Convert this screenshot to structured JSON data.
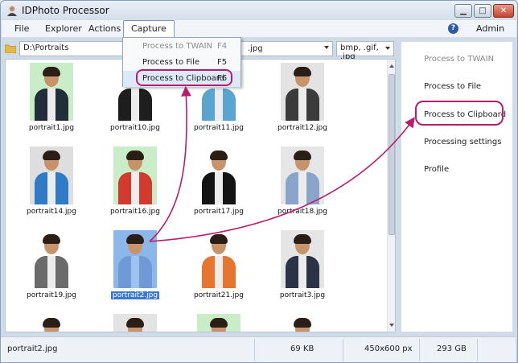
{
  "window": {
    "title": "IDPhoto Processor"
  },
  "window_controls": {
    "min": "▁",
    "max": "□",
    "close": "✕"
  },
  "menubar": {
    "items": [
      "File",
      "Explorer",
      "Actions",
      "Capture"
    ],
    "help": "?",
    "user": "Admin"
  },
  "toolbar": {
    "path": "D:\\Portraits",
    "path_type": ".jpg",
    "filter": "bmp, .gif, .jpg"
  },
  "capture_menu": {
    "items": [
      {
        "label": "Process to TWAIN",
        "shortcut": "F4",
        "disabled": true
      },
      {
        "label": "Process to File",
        "shortcut": "F5",
        "disabled": false
      },
      {
        "label": "Process to Clipboard",
        "shortcut": "F6",
        "disabled": false
      }
    ]
  },
  "gallery": {
    "items": [
      {
        "file": "portrait1.jpg",
        "bg": "#c9eec7",
        "shirt": "#222e3a"
      },
      {
        "file": "portrait10.jpg",
        "bg": "#ffffff",
        "shirt": "#1e1e1e"
      },
      {
        "file": "portrait11.jpg",
        "bg": "#ffffff",
        "shirt": "#5aa5d0"
      },
      {
        "file": "portrait12.jpg",
        "bg": "#e3e3e3",
        "shirt": "#3b3b3b"
      },
      {
        "file": "portrait14.jpg",
        "bg": "#dedede",
        "shirt": "#2f7bc8"
      },
      {
        "file": "portrait16.jpg",
        "bg": "#c9eec7",
        "shirt": "#d33a2e"
      },
      {
        "file": "portrait17.jpg",
        "bg": "#ffffff",
        "shirt": "#141414"
      },
      {
        "file": "portrait18.jpg",
        "bg": "#e6e6e6",
        "shirt": "#8aa4cc"
      },
      {
        "file": "portrait19.jpg",
        "bg": "#ffffff",
        "shirt": "#6b6b6b"
      },
      {
        "file": "portrait2.jpg",
        "bg": "#8bb7ea",
        "shirt": "#6f9ad6",
        "selected": true
      },
      {
        "file": "portrait21.jpg",
        "bg": "#ffffff",
        "shirt": "#e6752e"
      },
      {
        "file": "portrait3.jpg",
        "bg": "#e5e5e5",
        "shirt": "#2b3447"
      }
    ],
    "partial_row_bgs": [
      "#ffffff",
      "#e3e3e3",
      "#c9eec7",
      "#ffffff"
    ]
  },
  "side_panel": {
    "items": [
      {
        "label": "Process to TWAIN",
        "disabled": true
      },
      {
        "label": "Process to File",
        "disabled": false
      },
      {
        "label": "Process to Clipboard",
        "disabled": false
      },
      {
        "label": "Processing settings",
        "disabled": false
      },
      {
        "label": "Profile",
        "disabled": false
      }
    ]
  },
  "status": {
    "file": "portrait2.jpg",
    "size": "69 KB",
    "dimensions": "450x600 px",
    "free": "293 GB"
  },
  "colors": {
    "annotation": "#b81d6d",
    "selection": "#3a78d4"
  }
}
